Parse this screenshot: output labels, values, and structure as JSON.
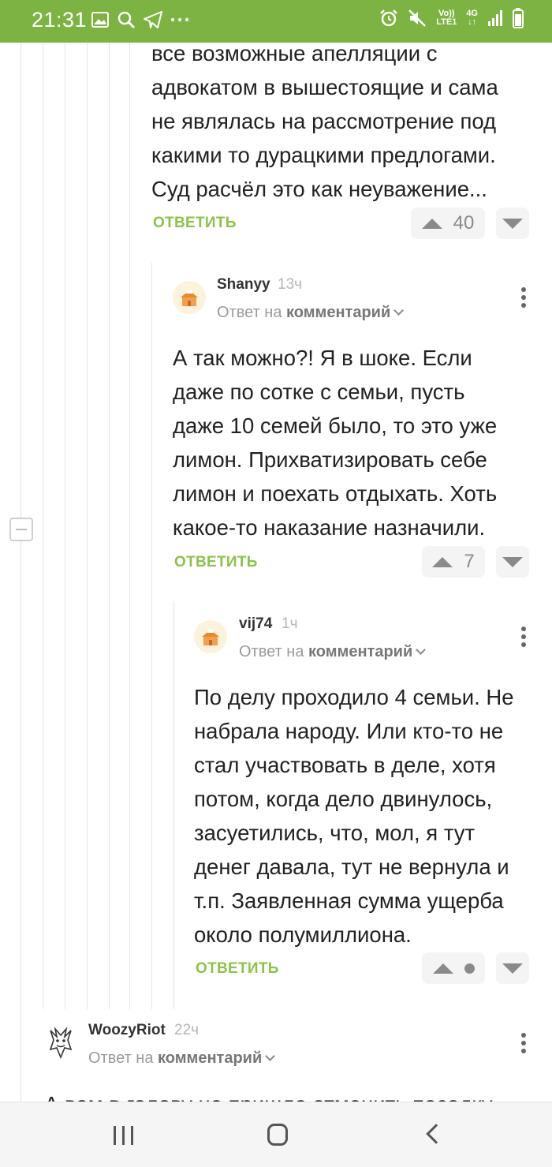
{
  "status_bar": {
    "time": "21:31",
    "volte": "Vo))",
    "lte": "LTE1",
    "network": "4G",
    "colors": {
      "background": "#7cb342",
      "text": "#ffffff"
    },
    "left_icons": [
      "gallery-icon",
      "search-icon",
      "telegram-icon",
      "more-icon"
    ],
    "right_icons": [
      "alarm-icon",
      "mute-icon",
      "signal-icon",
      "battery-icon"
    ]
  },
  "comment_top": {
    "text_lines": [
      "все возможные апелляции с",
      "адвокатом в вышестоящие и сама",
      "не являлась на рассмотрение под",
      "какими то дурацкими предлогами.",
      "Суд расчёл это как неуважение..."
    ],
    "reply_label": "ОТВЕТИТЬ",
    "rating": "40"
  },
  "comment_shanyy": {
    "author": "Shanyy",
    "time": "13ч",
    "reply_to_prefix": "Ответ на",
    "reply_to_link": "комментарий",
    "text_lines": [
      "А так можно?! Я в шоке. Если",
      "даже по сотке с семьи, пусть",
      "даже 10 семей было, то это уже",
      "лимон. Прихватизировать себе",
      "лимон и поехать отдыхать. Хоть",
      "какое-то наказание назначили."
    ],
    "reply_label": "ОТВЕТИТЬ",
    "rating": "7"
  },
  "comment_vij74": {
    "author": "vij74",
    "time": "1ч",
    "reply_to_prefix": "Ответ на",
    "reply_to_link": "комментарий",
    "text_lines": [
      "По делу проходило 4 семьи. Не",
      "набрала народу. Или кто-то не",
      "стал участвовать в деле, хотя",
      "потом, когда дело двинулось,",
      "засуетились, что, мол, я тут",
      "денег давала, тут не вернула и",
      "т.п. Заявленная сумма ущерба",
      "около полумиллиона."
    ],
    "reply_label": "ОТВЕТИТЬ"
  },
  "comment_woozy": {
    "author": "WoozyRiot",
    "time": "22ч",
    "reply_to_prefix": "Ответ на",
    "reply_to_link": "комментарий",
    "partial_text": "А вам в голову не пришло отменить посадку"
  },
  "theme": {
    "accent": "#8bc34a",
    "vote_bg": "#f4f4f4"
  },
  "nav_bar": {
    "icons": [
      "recent-apps-icon",
      "home-icon",
      "back-icon"
    ]
  }
}
